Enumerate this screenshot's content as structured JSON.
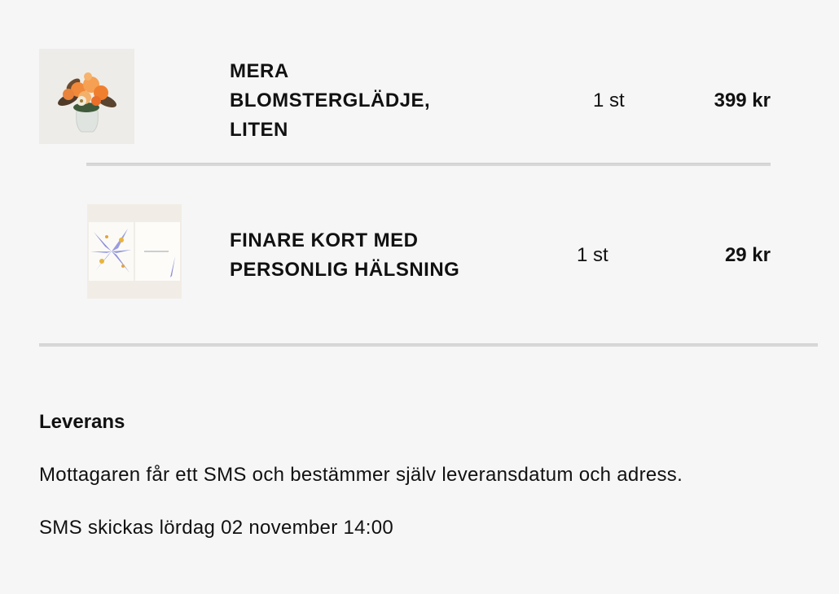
{
  "items": [
    {
      "name": "MERA BLOMSTERGLÄDJE, LITEN",
      "qty": "1 st",
      "price": "399 kr",
      "image": "flower-bouquet-image"
    },
    {
      "name": "FINARE KORT MED PERSONLIG HÄLSNING",
      "qty": "1 st",
      "price": "29 kr",
      "image": "greeting-card-image"
    }
  ],
  "delivery": {
    "title": "Leverans",
    "description": "Mottagaren får ett SMS och bestämmer själv leveransdatum och adress.",
    "sms_note": "SMS skickas lördag 02 november 14:00"
  }
}
